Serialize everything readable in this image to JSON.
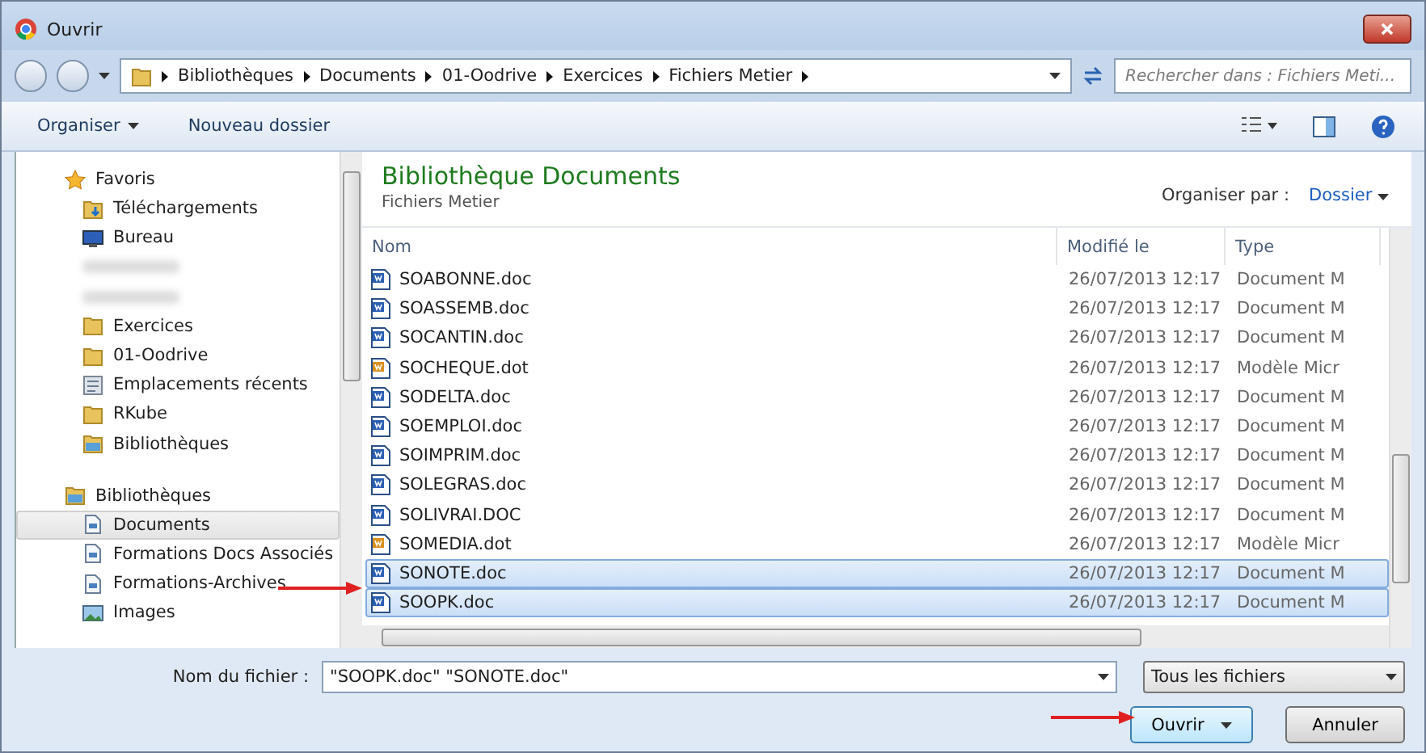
{
  "window": {
    "title": "Ouvrir"
  },
  "address": {
    "crumbs": [
      "Bibliothèques",
      "Documents",
      "01-Oodrive",
      "Exercices",
      "Fichiers Metier"
    ],
    "search_placeholder": "Rechercher dans : Fichiers Meti..."
  },
  "toolbar": {
    "organize": "Organiser",
    "new_folder": "Nouveau dossier"
  },
  "sidebar": {
    "groups": [
      {
        "label": "Favoris",
        "kind": "star",
        "children": [
          {
            "label": "Téléchargements",
            "kind": "download",
            "selected": false
          },
          {
            "label": "Bureau",
            "kind": "desktop",
            "selected": false
          },
          {
            "kind": "blurred",
            "selected": false
          },
          {
            "kind": "blurred",
            "selected": false
          },
          {
            "label": "Exercices",
            "kind": "folder",
            "selected": false
          },
          {
            "label": "01-Oodrive",
            "kind": "folder",
            "selected": false
          },
          {
            "label": "Emplacements récents",
            "kind": "recent",
            "selected": false
          },
          {
            "label": "RKube",
            "kind": "folder",
            "selected": false
          },
          {
            "label": "Bibliothèques",
            "kind": "library",
            "selected": false
          }
        ]
      },
      {
        "label": "Bibliothèques",
        "kind": "library",
        "children": [
          {
            "label": "Documents",
            "kind": "document",
            "selected": true
          },
          {
            "label": "Formations Docs Associés",
            "kind": "document",
            "selected": false
          },
          {
            "label": "Formations-Archives",
            "kind": "document",
            "selected": false
          },
          {
            "label": "Images",
            "kind": "image",
            "selected": false
          }
        ]
      }
    ]
  },
  "content": {
    "title": "Bibliothèque Documents",
    "subtitle": "Fichiers Metier",
    "arrange_label": "Organiser par :",
    "arrange_value": "Dossier"
  },
  "table": {
    "columns": [
      "Nom",
      "Modifié le",
      "Type"
    ],
    "rows": [
      {
        "name": "SOABONNE.doc",
        "kind": "doc",
        "modified": "26/07/2013 12:17",
        "type": "Document M",
        "selected": false
      },
      {
        "name": "SOASSEMB.doc",
        "kind": "doc",
        "modified": "26/07/2013 12:17",
        "type": "Document M",
        "selected": false
      },
      {
        "name": "SOCANTIN.doc",
        "kind": "doc",
        "modified": "26/07/2013 12:17",
        "type": "Document M",
        "selected": false
      },
      {
        "name": "SOCHEQUE.dot",
        "kind": "dot",
        "modified": "26/07/2013 12:17",
        "type": "Modèle Micr",
        "selected": false
      },
      {
        "name": "SODELTA.doc",
        "kind": "doc",
        "modified": "26/07/2013 12:17",
        "type": "Document M",
        "selected": false
      },
      {
        "name": "SOEMPLOI.doc",
        "kind": "doc",
        "modified": "26/07/2013 12:17",
        "type": "Document M",
        "selected": false
      },
      {
        "name": "SOIMPRIM.doc",
        "kind": "doc",
        "modified": "26/07/2013 12:17",
        "type": "Document M",
        "selected": false
      },
      {
        "name": "SOLEGRAS.doc",
        "kind": "doc",
        "modified": "26/07/2013 12:17",
        "type": "Document M",
        "selected": false
      },
      {
        "name": "SOLIVRAI.DOC",
        "kind": "doc",
        "modified": "26/07/2013 12:17",
        "type": "Document M",
        "selected": false
      },
      {
        "name": "SOMEDIA.dot",
        "kind": "dot",
        "modified": "26/07/2013 12:17",
        "type": "Modèle Micr",
        "selected": false
      },
      {
        "name": "SONOTE.doc",
        "kind": "doc",
        "modified": "26/07/2013 12:17",
        "type": "Document M",
        "selected": true
      },
      {
        "name": "SOOPK.doc",
        "kind": "doc",
        "modified": "26/07/2013 12:17",
        "type": "Document M",
        "selected": true
      }
    ]
  },
  "footer": {
    "filename_label": "Nom du fichier :",
    "filename_value": "\"SOOPK.doc\" \"SONOTE.doc\"",
    "filter": "Tous les fichiers",
    "open": "Ouvrir",
    "cancel": "Annuler"
  }
}
